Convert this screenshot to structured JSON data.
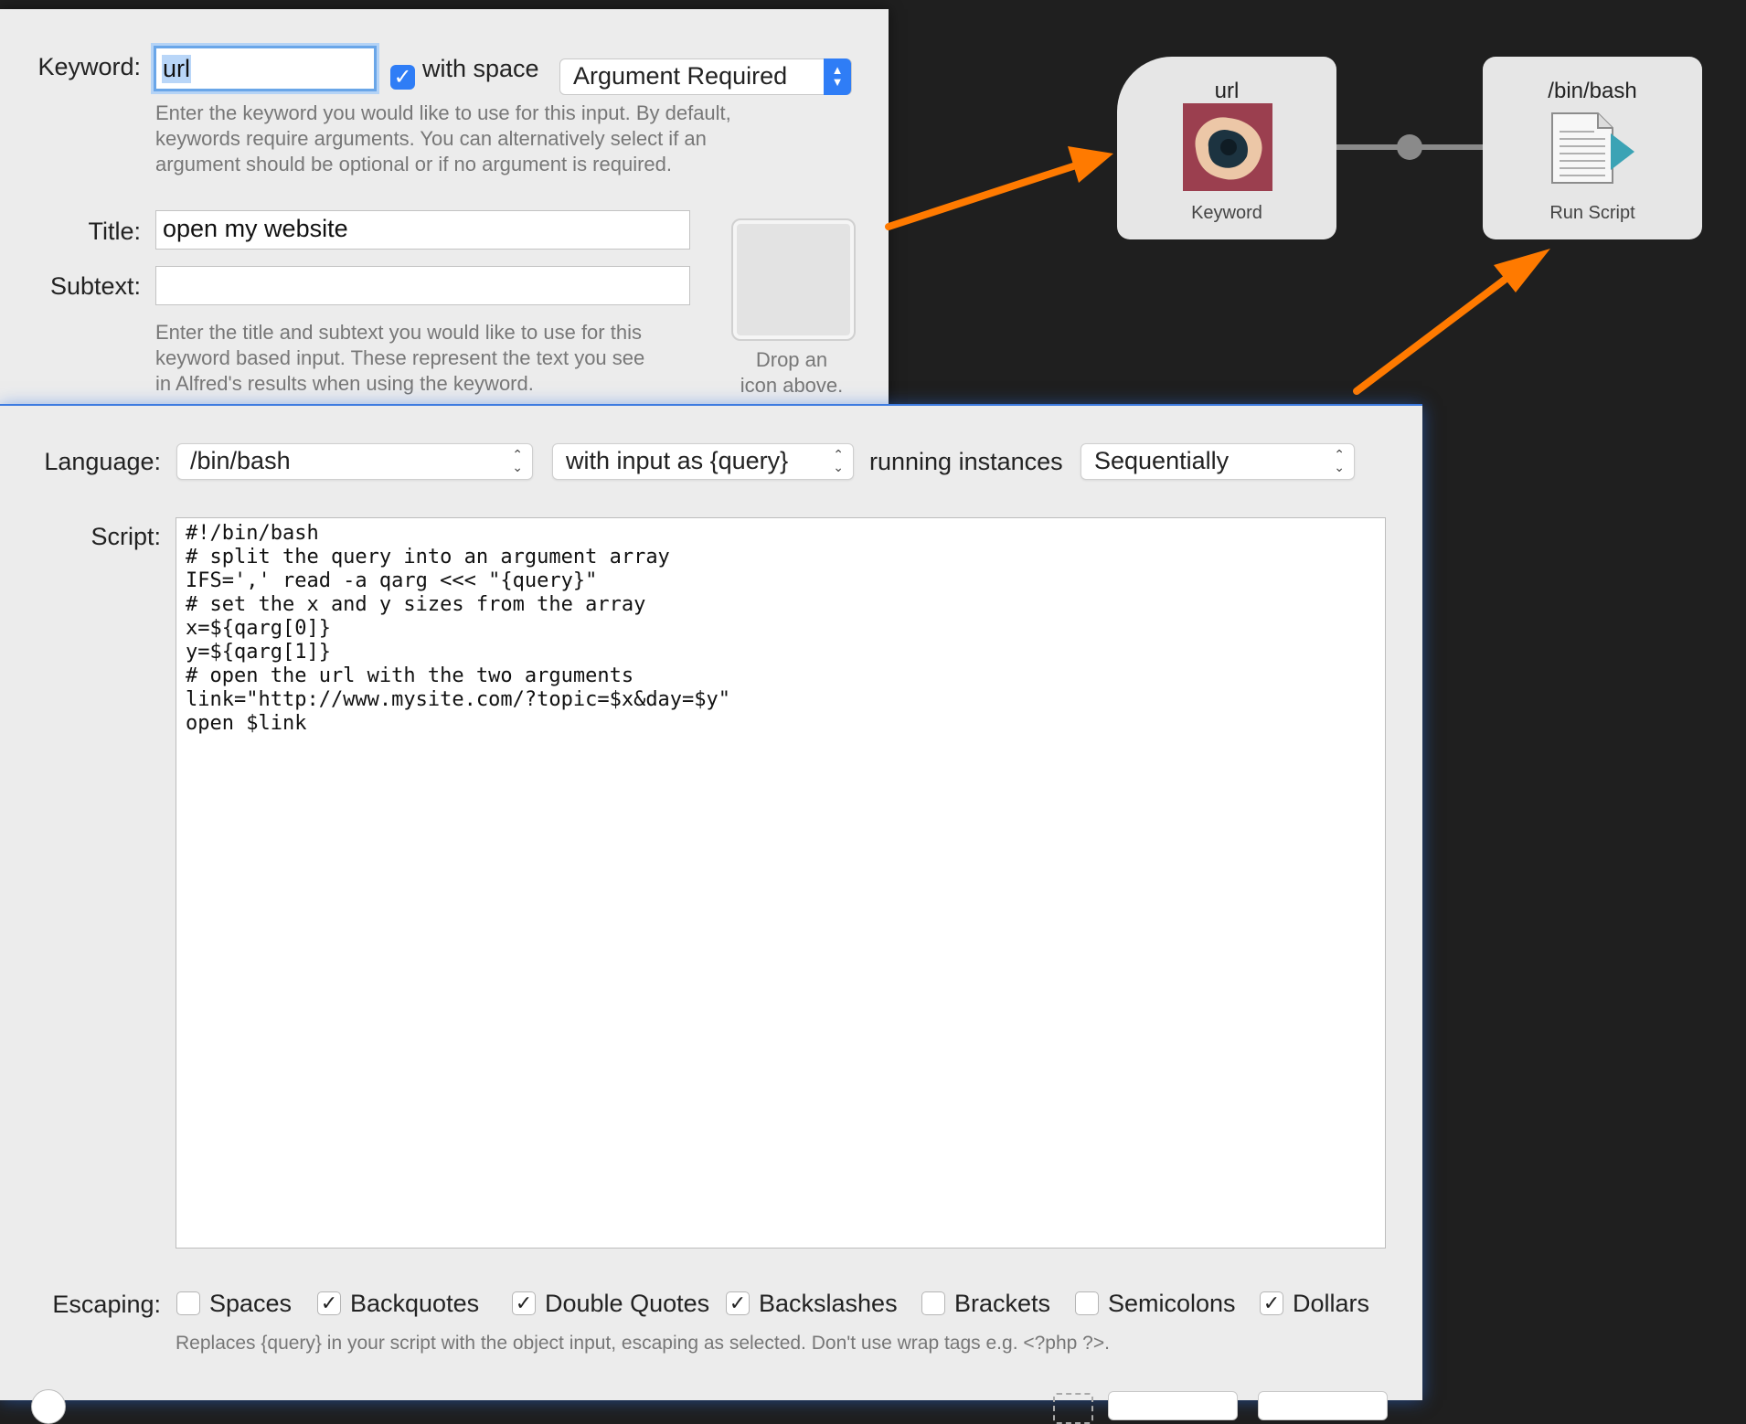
{
  "keyword_panel": {
    "keyword_label": "Keyword:",
    "keyword_value": "url",
    "with_space_label": "with space",
    "with_space_checked": true,
    "argument_mode": "Argument Required",
    "keyword_help": [
      "Enter the keyword you would like to use for this input. By default,",
      "keywords require arguments. You can alternatively select if an",
      "argument should be optional or if no argument is required."
    ],
    "title_label": "Title:",
    "title_value": "open my website",
    "subtext_label": "Subtext:",
    "subtext_value": "",
    "title_help": [
      "Enter the title and subtext you would like to use for this",
      "keyword based input. These represent the text you see",
      "in Alfred's results when using the keyword."
    ],
    "icon_drop_hint": [
      "Drop an",
      "icon above."
    ]
  },
  "canvas": {
    "keyword_node": {
      "title": "url",
      "subtitle": "Keyword"
    },
    "script_node": {
      "title": "/bin/bash",
      "subtitle": "Run Script"
    },
    "arrow_color": "#ff7a00",
    "connector_color": "#8a8a8a"
  },
  "script_panel": {
    "language_label": "Language:",
    "language_value": "/bin/bash",
    "input_mode": "with input as {query}",
    "running_instances_label": "running instances",
    "running_instances_value": "Sequentially",
    "script_label": "Script:",
    "script_lines": [
      "#!/bin/bash",
      "",
      "# split the query into an argument array",
      "IFS=',' read -a qarg <<< \"{query}\"",
      "",
      "# set the x and y sizes from the array",
      "x=${qarg[0]}",
      "y=${qarg[1]}",
      "",
      "# open the url with the two arguments",
      "link=\"http://www.mysite.com/?topic=$x&day=$y\"",
      "open $link"
    ],
    "escaping_label": "Escaping:",
    "escaping": [
      {
        "label": "Spaces",
        "checked": false
      },
      {
        "label": "Backquotes",
        "checked": true
      },
      {
        "label": "Double Quotes",
        "checked": true
      },
      {
        "label": "Backslashes",
        "checked": true
      },
      {
        "label": "Brackets",
        "checked": false
      },
      {
        "label": "Semicolons",
        "checked": false
      },
      {
        "label": "Dollars",
        "checked": true
      }
    ],
    "escaping_help": "Replaces {query} in your script with the object input, escaping as selected. Don't use wrap tags e.g. <?php ?>."
  }
}
